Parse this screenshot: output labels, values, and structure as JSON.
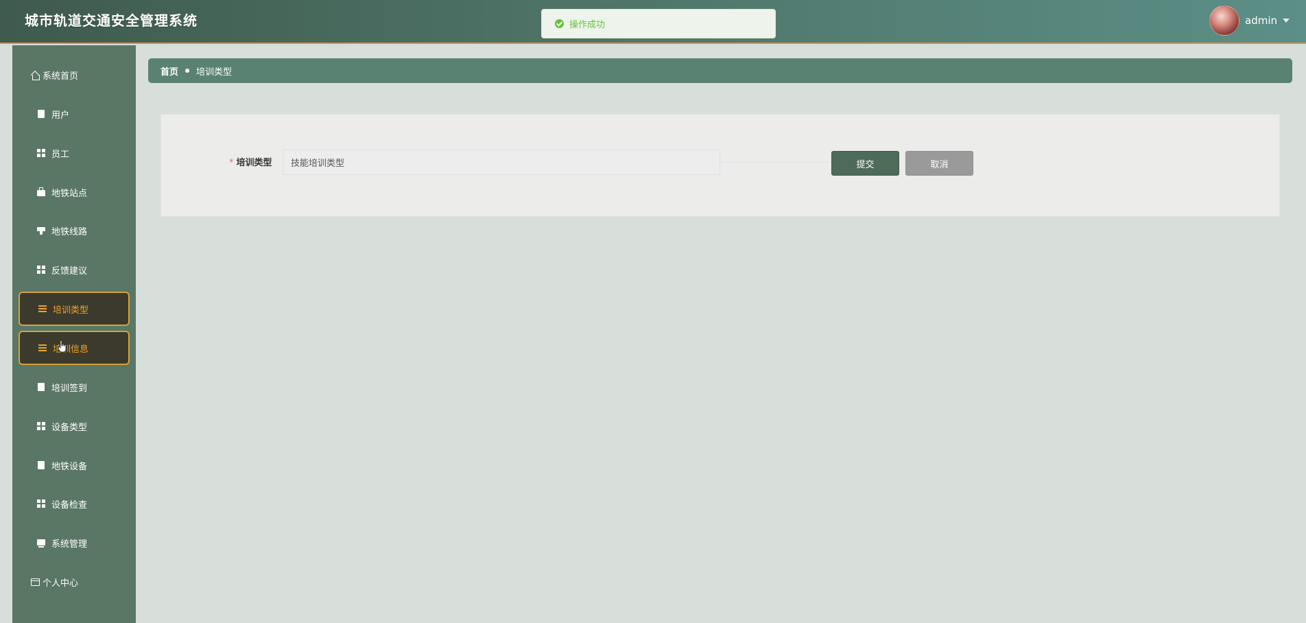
{
  "header": {
    "title": "城市轨道交通安全管理系统",
    "username": "admin"
  },
  "toast": {
    "message": "操作成功",
    "status_color": "#67c23a"
  },
  "sidebar": {
    "items": [
      {
        "label": "系统首页",
        "icon": "home-icon"
      },
      {
        "label": "用户",
        "icon": "clipboard-icon"
      },
      {
        "label": "员工",
        "icon": "grid-icon"
      },
      {
        "label": "地铁站点",
        "icon": "briefcase-icon"
      },
      {
        "label": "地铁线路",
        "icon": "stamp-icon"
      },
      {
        "label": "反馈建议",
        "icon": "grid-icon"
      },
      {
        "label": "培训类型",
        "icon": "list-icon",
        "active": true
      },
      {
        "label": "培训信息",
        "icon": "list-icon",
        "active": true
      },
      {
        "label": "培训签到",
        "icon": "clipboard-icon"
      },
      {
        "label": "设备类型",
        "icon": "grid-icon"
      },
      {
        "label": "地铁设备",
        "icon": "clipboard-icon"
      },
      {
        "label": "设备检查",
        "icon": "grid-icon"
      },
      {
        "label": "系统管理",
        "icon": "monitor-icon"
      },
      {
        "label": "个人中心",
        "icon": "card-icon"
      }
    ]
  },
  "breadcrumb": {
    "home": "首页",
    "current": "培训类型"
  },
  "form": {
    "field_label": "培训类型",
    "required_mark": "*",
    "field_value": "技能培训类型",
    "submit_label": "提交",
    "cancel_label": "取消"
  },
  "colors": {
    "accent": "#f0a52a",
    "sidebar": "#5a7665",
    "breadcrumb": "#5a8272"
  }
}
